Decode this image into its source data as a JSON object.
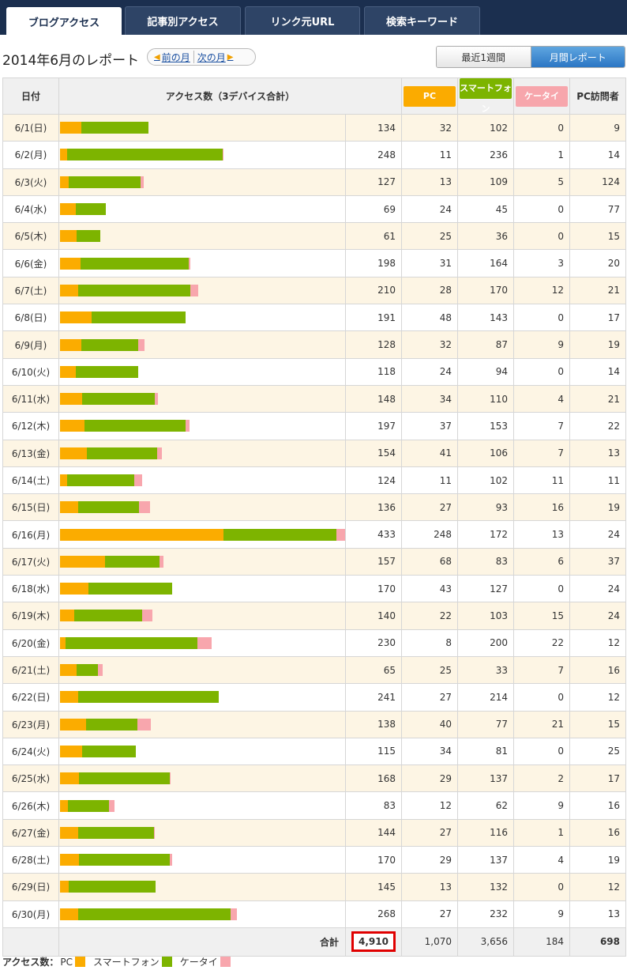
{
  "tabs": [
    {
      "label": "ブログアクセス",
      "active": true
    },
    {
      "label": "記事別アクセス",
      "active": false
    },
    {
      "label": "リンク元URL",
      "active": false
    },
    {
      "label": "検索キーワード",
      "active": false
    }
  ],
  "report": {
    "title": "2014年6月のレポート",
    "prev_label": "前の月",
    "next_label": "次の月",
    "period_buttons": [
      {
        "label": "最近1週間",
        "active": false
      },
      {
        "label": "月間レポート",
        "active": true
      }
    ]
  },
  "table": {
    "headers": {
      "date": "日付",
      "access": "アクセス数（3デバイス合計）",
      "pc": "PC",
      "sp": "スマートフォン",
      "kt": "ケータイ",
      "visitors": "PC訪問者"
    },
    "rows": [
      {
        "date": "6/1(日)",
        "total": "134",
        "pc": "32",
        "sp": "102",
        "kt": "0",
        "visitors": "9"
      },
      {
        "date": "6/2(月)",
        "total": "248",
        "pc": "11",
        "sp": "236",
        "kt": "1",
        "visitors": "14"
      },
      {
        "date": "6/3(火)",
        "total": "127",
        "pc": "13",
        "sp": "109",
        "kt": "5",
        "visitors": "124"
      },
      {
        "date": "6/4(水)",
        "total": "69",
        "pc": "24",
        "sp": "45",
        "kt": "0",
        "visitors": "77"
      },
      {
        "date": "6/5(木)",
        "total": "61",
        "pc": "25",
        "sp": "36",
        "kt": "0",
        "visitors": "15"
      },
      {
        "date": "6/6(金)",
        "total": "198",
        "pc": "31",
        "sp": "164",
        "kt": "3",
        "visitors": "20"
      },
      {
        "date": "6/7(土)",
        "total": "210",
        "pc": "28",
        "sp": "170",
        "kt": "12",
        "visitors": "21"
      },
      {
        "date": "6/8(日)",
        "total": "191",
        "pc": "48",
        "sp": "143",
        "kt": "0",
        "visitors": "17"
      },
      {
        "date": "6/9(月)",
        "total": "128",
        "pc": "32",
        "sp": "87",
        "kt": "9",
        "visitors": "19"
      },
      {
        "date": "6/10(火)",
        "total": "118",
        "pc": "24",
        "sp": "94",
        "kt": "0",
        "visitors": "14"
      },
      {
        "date": "6/11(水)",
        "total": "148",
        "pc": "34",
        "sp": "110",
        "kt": "4",
        "visitors": "21"
      },
      {
        "date": "6/12(木)",
        "total": "197",
        "pc": "37",
        "sp": "153",
        "kt": "7",
        "visitors": "22"
      },
      {
        "date": "6/13(金)",
        "total": "154",
        "pc": "41",
        "sp": "106",
        "kt": "7",
        "visitors": "13"
      },
      {
        "date": "6/14(土)",
        "total": "124",
        "pc": "11",
        "sp": "102",
        "kt": "11",
        "visitors": "11"
      },
      {
        "date": "6/15(日)",
        "total": "136",
        "pc": "27",
        "sp": "93",
        "kt": "16",
        "visitors": "19"
      },
      {
        "date": "6/16(月)",
        "total": "433",
        "pc": "248",
        "sp": "172",
        "kt": "13",
        "visitors": "24"
      },
      {
        "date": "6/17(火)",
        "total": "157",
        "pc": "68",
        "sp": "83",
        "kt": "6",
        "visitors": "37"
      },
      {
        "date": "6/18(水)",
        "total": "170",
        "pc": "43",
        "sp": "127",
        "kt": "0",
        "visitors": "24"
      },
      {
        "date": "6/19(木)",
        "total": "140",
        "pc": "22",
        "sp": "103",
        "kt": "15",
        "visitors": "24"
      },
      {
        "date": "6/20(金)",
        "total": "230",
        "pc": "8",
        "sp": "200",
        "kt": "22",
        "visitors": "12"
      },
      {
        "date": "6/21(土)",
        "total": "65",
        "pc": "25",
        "sp": "33",
        "kt": "7",
        "visitors": "16"
      },
      {
        "date": "6/22(日)",
        "total": "241",
        "pc": "27",
        "sp": "214",
        "kt": "0",
        "visitors": "12"
      },
      {
        "date": "6/23(月)",
        "total": "138",
        "pc": "40",
        "sp": "77",
        "kt": "21",
        "visitors": "15"
      },
      {
        "date": "6/24(火)",
        "total": "115",
        "pc": "34",
        "sp": "81",
        "kt": "0",
        "visitors": "25"
      },
      {
        "date": "6/25(水)",
        "total": "168",
        "pc": "29",
        "sp": "137",
        "kt": "2",
        "visitors": "17"
      },
      {
        "date": "6/26(木)",
        "total": "83",
        "pc": "12",
        "sp": "62",
        "kt": "9",
        "visitors": "16"
      },
      {
        "date": "6/27(金)",
        "total": "144",
        "pc": "27",
        "sp": "116",
        "kt": "1",
        "visitors": "16"
      },
      {
        "date": "6/28(土)",
        "total": "170",
        "pc": "29",
        "sp": "137",
        "kt": "4",
        "visitors": "19"
      },
      {
        "date": "6/29(日)",
        "total": "145",
        "pc": "13",
        "sp": "132",
        "kt": "0",
        "visitors": "12"
      },
      {
        "date": "6/30(月)",
        "total": "268",
        "pc": "27",
        "sp": "232",
        "kt": "9",
        "visitors": "13"
      }
    ],
    "totals": {
      "label": "合計",
      "total": "4,910",
      "pc": "1,070",
      "sp": "3,656",
      "kt": "184",
      "visitors": "698"
    }
  },
  "legend": {
    "label": "アクセス数：",
    "items": [
      {
        "name": "PC",
        "color": "#fbac00"
      },
      {
        "name": "スマートフォン",
        "color": "#7db400"
      },
      {
        "name": "ケータイ",
        "color": "#f8a6ad"
      }
    ]
  },
  "colors": {
    "pc": "#fbac00",
    "smartphone": "#7db400",
    "keitai": "#f8a6ad",
    "tabbar": "#1b2f4f"
  }
}
